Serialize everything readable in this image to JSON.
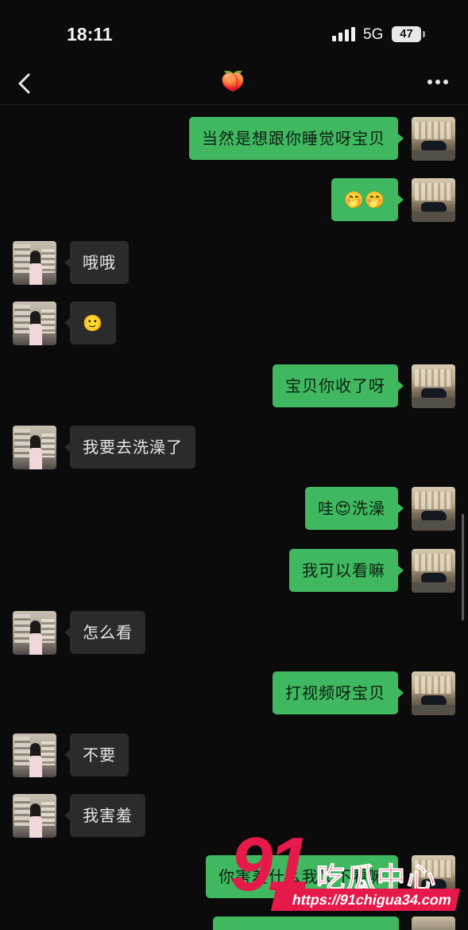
{
  "status_bar": {
    "time": "18:11",
    "network": "5G",
    "battery": "47"
  },
  "chat": {
    "title_emoji": "🍑",
    "messages": [
      {
        "from": "me",
        "text": "当然是想跟你睡觉呀宝贝"
      },
      {
        "from": "me",
        "text": "🤭🤭"
      },
      {
        "from": "her",
        "text": "哦哦"
      },
      {
        "from": "her",
        "text": "🙂"
      },
      {
        "from": "me",
        "text": "宝贝你收了呀"
      },
      {
        "from": "her",
        "text": "我要去洗澡了"
      },
      {
        "from": "me",
        "text": "哇😍洗澡"
      },
      {
        "from": "me",
        "text": "我可以看嘛"
      },
      {
        "from": "her",
        "text": "怎么看"
      },
      {
        "from": "me",
        "text": "打视频呀宝贝"
      },
      {
        "from": "her",
        "text": "不要"
      },
      {
        "from": "her",
        "text": "我害羞"
      },
      {
        "from": "me",
        "text": "你害羞什么我又不看嘛"
      }
    ]
  },
  "watermark": {
    "number": "91",
    "name": "吃瓜中心",
    "url": "https://91chigua34.com",
    "color": "#e5194a"
  },
  "colors": {
    "outgoing_bubble": "#3fb85f",
    "incoming_bubble": "#2b2b2b",
    "background": "#0b0b0b"
  },
  "icons": {
    "back": "chevron-left-icon",
    "more": "more-dots-icon",
    "signal": "signal-bars-icon"
  }
}
